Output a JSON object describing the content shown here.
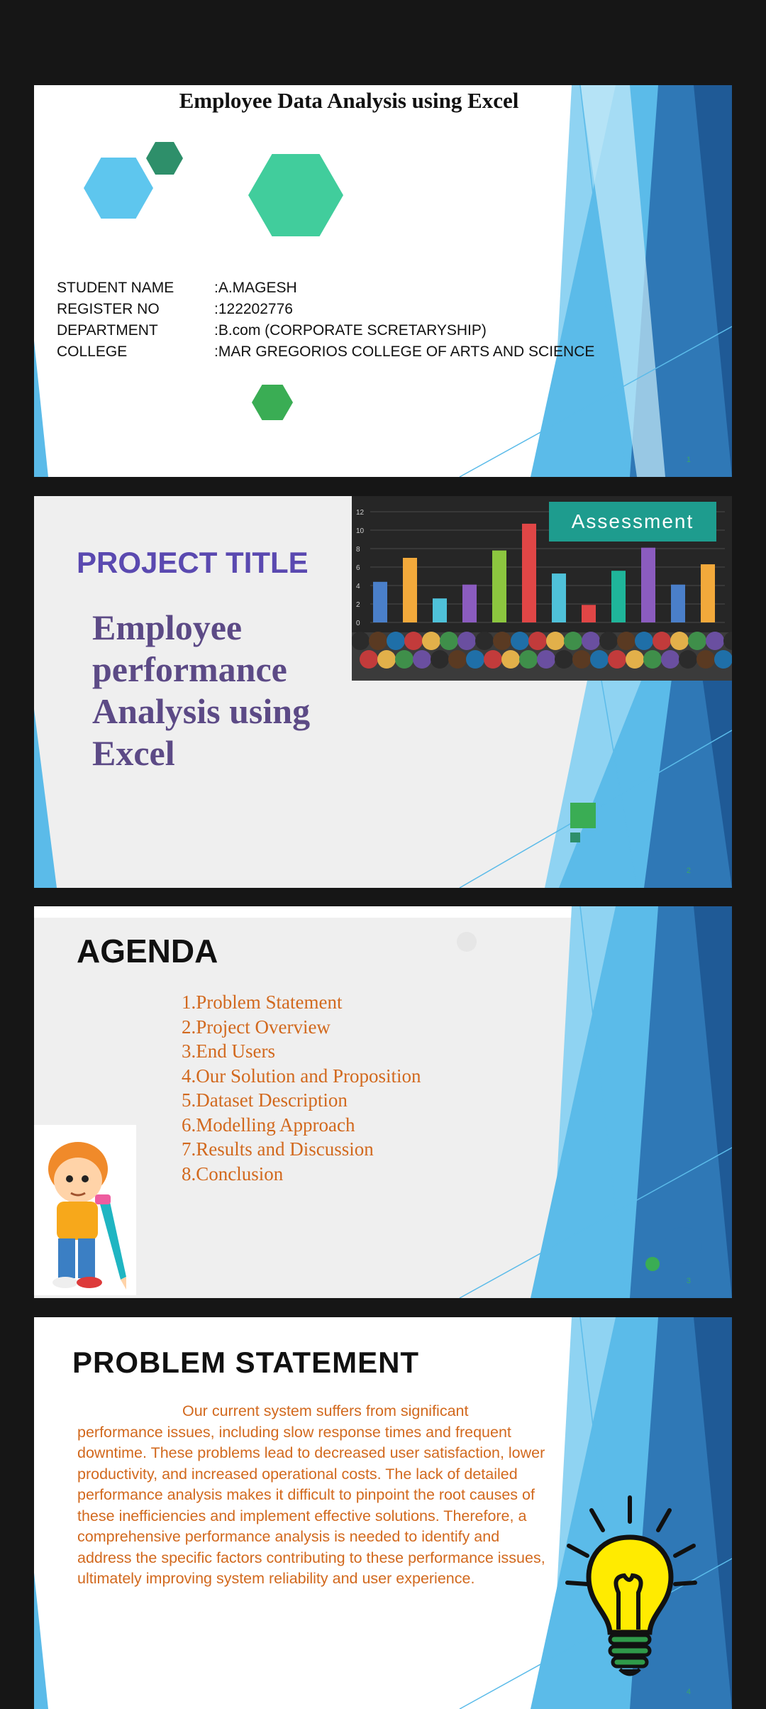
{
  "slide1": {
    "title": "Employee Data Analysis using Excel",
    "rows": [
      {
        "label": "STUDENT NAME",
        "value": ":A.MAGESH"
      },
      {
        "label": "REGISTER NO",
        "value": ":122202776"
      },
      {
        "label": "DEPARTMENT",
        "value": ":B.com (CORPORATE SCRETARYSHIP)"
      },
      {
        "label": "COLLEGE",
        "value": ":MAR GREGORIOS COLLEGE OF ARTS AND SCIENCE"
      }
    ],
    "page_number": "1"
  },
  "slide2": {
    "heading": "PROJECT TITLE",
    "title": "Employee performance Analysis using Excel",
    "image_badge": "Assessment",
    "chart_ticks": [
      "12",
      "10",
      "8",
      "6",
      "4",
      "2",
      "0"
    ],
    "bar_colors": [
      "#4a7fc9",
      "#f2a93b",
      "#4fc1d9",
      "#8b5cbf",
      "#8cc63f",
      "#e04646",
      "#4fc1d9",
      "#e04646",
      "#1fb59a",
      "#8b5cbf",
      "#4a7fc9",
      "#f2a93b"
    ],
    "bar_values": [
      4.4,
      7,
      2.6,
      4.1,
      7.8,
      10.7,
      5.3,
      1.9,
      5.6,
      8.1,
      4.1,
      6.3
    ],
    "page_number": "2"
  },
  "slide3": {
    "heading": "AGENDA",
    "items": [
      "1.Problem Statement",
      "2.Project Overview",
      "3.End Users",
      "4.Our Solution and Proposition",
      "5.Dataset Description",
      "6.Modelling Approach",
      "7.Results and Discussion",
      "8.Conclusion"
    ],
    "page_number": "3"
  },
  "slide4": {
    "heading": "PROBLEM  STATEMENT",
    "body": "Our current system suffers from significant performance issues, including slow response times and frequent downtime. These problems lead to decreased user satisfaction, lower productivity, and increased operational costs. The lack of detailed performance analysis makes it difficult to pinpoint the root causes of these inefficiencies and implement effective solutions. Therefore, a comprehensive performance analysis is needed to identify and address the specific factors contributing to these performance issues, ultimately improving system reliability and user experience.",
    "page_number": "4"
  },
  "colors": {
    "page_background": "#161616",
    "accent_purple": "#5a49b0",
    "agenda_orange": "#d2691e",
    "blue_light": "#8fd3f2",
    "blue_mid": "#3aa6de",
    "blue_dark": "#2a6eae"
  }
}
